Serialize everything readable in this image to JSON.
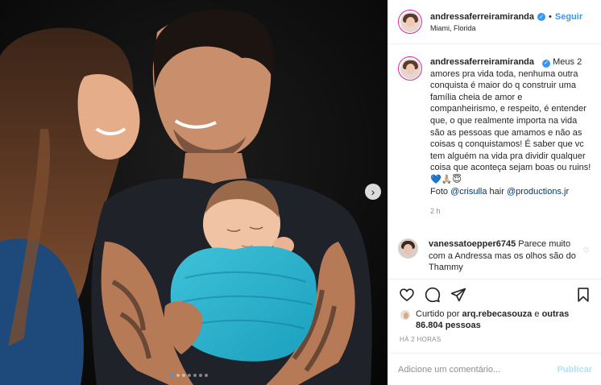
{
  "post": {
    "author": {
      "username": "andressaferreiramiranda",
      "verified_glyph": "✓",
      "separator": "•",
      "follow_label": "Seguir",
      "location": "Miami, Florida"
    },
    "media": {
      "description_icon": "family-photo",
      "next_glyph": "›",
      "carousel_dots": 7,
      "active_dot": 0
    },
    "caption": {
      "username": "andressaferreiramiranda",
      "text": "Meus 2 amores pra vida toda, nenhuma outra conquista é maior do q construir uma família cheia de amor e companheirismo, e respeito, é entender que, o que realmente importa na vida são as pessoas que amamos e não as coisas q conquistamos! É saber que vc tem alguém na vida pra dividir qualquer coisa que aconteça sejam boas ou ruins! 💙🙏🏼😇",
      "credit_prefix": "Foto",
      "mention_1": "@crisulla",
      "credit_mid": "hair",
      "mention_2": "@productions.jr",
      "time_ago": "2 h"
    },
    "comments": [
      {
        "username": "vanessatoepper6745",
        "text": "Parece muito com a Andressa mas os olhos são do Thammy",
        "heart_glyph": "♡"
      }
    ],
    "likes": {
      "prefix": "Curtido por",
      "first_user": "arq.rebecasouza",
      "middle": "e",
      "others": "outras 86.804 pessoas"
    },
    "posted_time": "HÁ 2 HORAS",
    "comment_box": {
      "placeholder": "Adicione um comentário...",
      "publish_label": "Publicar"
    },
    "colors": {
      "accent": "#3897f0",
      "publish_disabled": "#b2dffc",
      "mention": "#00376b",
      "muted": "#8e8e8e",
      "border": "#efefef"
    }
  }
}
